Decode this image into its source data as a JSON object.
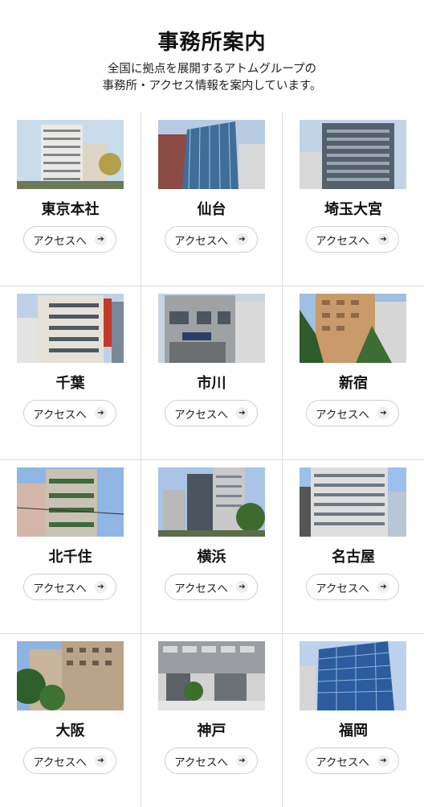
{
  "header": {
    "title": "事務所案内",
    "subtitle_line1": "全国に拠点を展開するアトムグループの",
    "subtitle_line2": "事務所・アクセス情報を案内しています。"
  },
  "access_label": "アクセスへ",
  "offices": [
    {
      "name": "東京本社",
      "photo_icon": "tokyo-building"
    },
    {
      "name": "仙台",
      "photo_icon": "sendai-building"
    },
    {
      "name": "埼玉大宮",
      "photo_icon": "omiya-building"
    },
    {
      "name": "千葉",
      "photo_icon": "chiba-building"
    },
    {
      "name": "市川",
      "photo_icon": "ichikawa-building"
    },
    {
      "name": "新宿",
      "photo_icon": "shinjuku-building"
    },
    {
      "name": "北千住",
      "photo_icon": "kitasenju-building"
    },
    {
      "name": "横浜",
      "photo_icon": "yokohama-building"
    },
    {
      "name": "名古屋",
      "photo_icon": "nagoya-building"
    },
    {
      "name": "大阪",
      "photo_icon": "osaka-building"
    },
    {
      "name": "神戸",
      "photo_icon": "kobe-building"
    },
    {
      "name": "福岡",
      "photo_icon": "fukuoka-building"
    }
  ],
  "colors": {
    "divider": "#dcdcdc",
    "button_border": "#d0d0d0",
    "arrow_bg": "#eeeeee",
    "text": "#111111"
  }
}
